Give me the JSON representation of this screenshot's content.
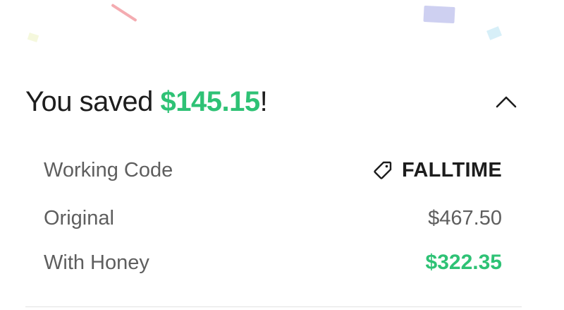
{
  "header": {
    "title_prefix": "You saved ",
    "amount": "$145.15",
    "title_suffix": "!"
  },
  "details": {
    "working_code": {
      "label": "Working Code",
      "value": "FALLTIME",
      "icon": "tag-icon"
    },
    "original": {
      "label": "Original",
      "value": "$467.50"
    },
    "with_honey": {
      "label": "With Honey",
      "value": "$322.35"
    }
  },
  "colors": {
    "accent_green": "#2ec275",
    "text_dark": "#1d1d1d",
    "text_muted": "#5e5e5e"
  },
  "collapse_icon": "chevron-up-icon"
}
